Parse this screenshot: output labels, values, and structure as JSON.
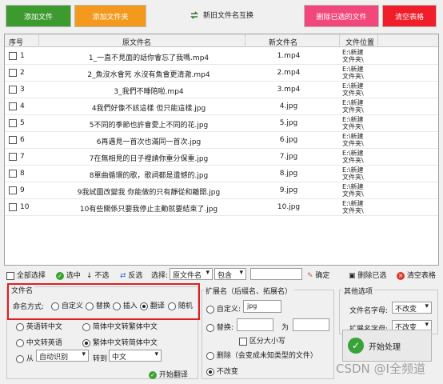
{
  "toolbar": {
    "add_file": "添加文件",
    "add_folder": "添加文件夹",
    "swap": "新旧文件名互换",
    "delete_selected": "删除已选的文件",
    "clear_table": "清空表格"
  },
  "grid": {
    "headers": [
      "序号",
      "原文件名",
      "新文件名",
      "文件位置"
    ],
    "rows": [
      {
        "num": "1",
        "old": "1_一直不見面的話你會忘了我嗎.mp4",
        "new": "1.mp4",
        "loc1": "E:\\新建",
        "loc2": "文件夹\\"
      },
      {
        "num": "2",
        "old": "2_魚沒水會死 水沒有魚會更清澈.mp4",
        "new": "2.mp4",
        "loc1": "E:\\新建",
        "loc2": "文件夹\\"
      },
      {
        "num": "3",
        "old": "3_我們不睡陪啦.mp4",
        "new": "3.mp4",
        "loc1": "E:\\新建",
        "loc2": "文件夹\\"
      },
      {
        "num": "4",
        "old": "4我們好像不該這樣 但只能這樣.jpg",
        "new": "4.jpg",
        "loc1": "E:\\新建",
        "loc2": "文件夹\\"
      },
      {
        "num": "5",
        "old": "5不同的季節也許會愛上不同的花.jpg",
        "new": "5.jpg",
        "loc1": "E:\\新建",
        "loc2": "文件夹\\"
      },
      {
        "num": "6",
        "old": "6再遇見一首次也滿同一首次.jpg",
        "new": "6.jpg",
        "loc1": "E:\\新建",
        "loc2": "文件夹\\"
      },
      {
        "num": "7",
        "old": "7在無相見的日子裡請你重分保重.jpg",
        "new": "7.jpg",
        "loc1": "E:\\新建",
        "loc2": "文件夹\\"
      },
      {
        "num": "8",
        "old": "8單曲循環的歌，歌詞都是遺憾的.jpg",
        "new": "8.jpg",
        "loc1": "E:\\新建",
        "loc2": "文件夹\\"
      },
      {
        "num": "9",
        "old": "9我試圖改變我 你能做的只有靜從和離開.jpg",
        "new": "9.jpg",
        "loc1": "E:\\新建",
        "loc2": "文件夹\\"
      },
      {
        "num": "10",
        "old": "10有些關係只要我停止主動就要結束了.jpg",
        "new": "10.jpg",
        "loc1": "E:\\新建",
        "loc2": "文件夹\\"
      }
    ]
  },
  "selectbar": {
    "select_all": "全部选择",
    "select": "选中",
    "unselect": "不选",
    "invert": "反选",
    "choose_label": "选择:",
    "field": "原文件名",
    "match": "包含",
    "confirm": "确定",
    "delete_selected": "删除已选",
    "clear_table": "清空表格"
  },
  "filename_panel": {
    "title": "文件名",
    "mode_label": "命名方式:",
    "modes": [
      "自定义",
      "替换",
      "插入",
      "翻译",
      "随机"
    ],
    "selected_mode": "翻译",
    "options": [
      "英语转中文",
      "简体中文转繁体中文",
      "中文转英语",
      "繁体中文转简体中文"
    ],
    "from_label": "从",
    "from_value": "自动识别",
    "to_label": "转到",
    "to_value": "中文",
    "start_translate": "开始翻译"
  },
  "ext_panel": {
    "title": "扩展名（后缀名、拓展名）",
    "custom_label": "自定义:",
    "custom_value": "jpg",
    "replace_label": "替换:",
    "replace_with": "为",
    "case_label": "区分大小写",
    "delete_label": "删除（会变成未知类型的文件）",
    "unchanged_label": "不改变"
  },
  "other_panel": {
    "title": "其他选项",
    "filename_case_label": "文件名字母:",
    "filename_case_value": "不改变",
    "ext_case_label": "扩展名字母:",
    "ext_case_value": "不改变"
  },
  "start_button": "开始处理",
  "watermark": "CSDN @Ⅰ全频道"
}
